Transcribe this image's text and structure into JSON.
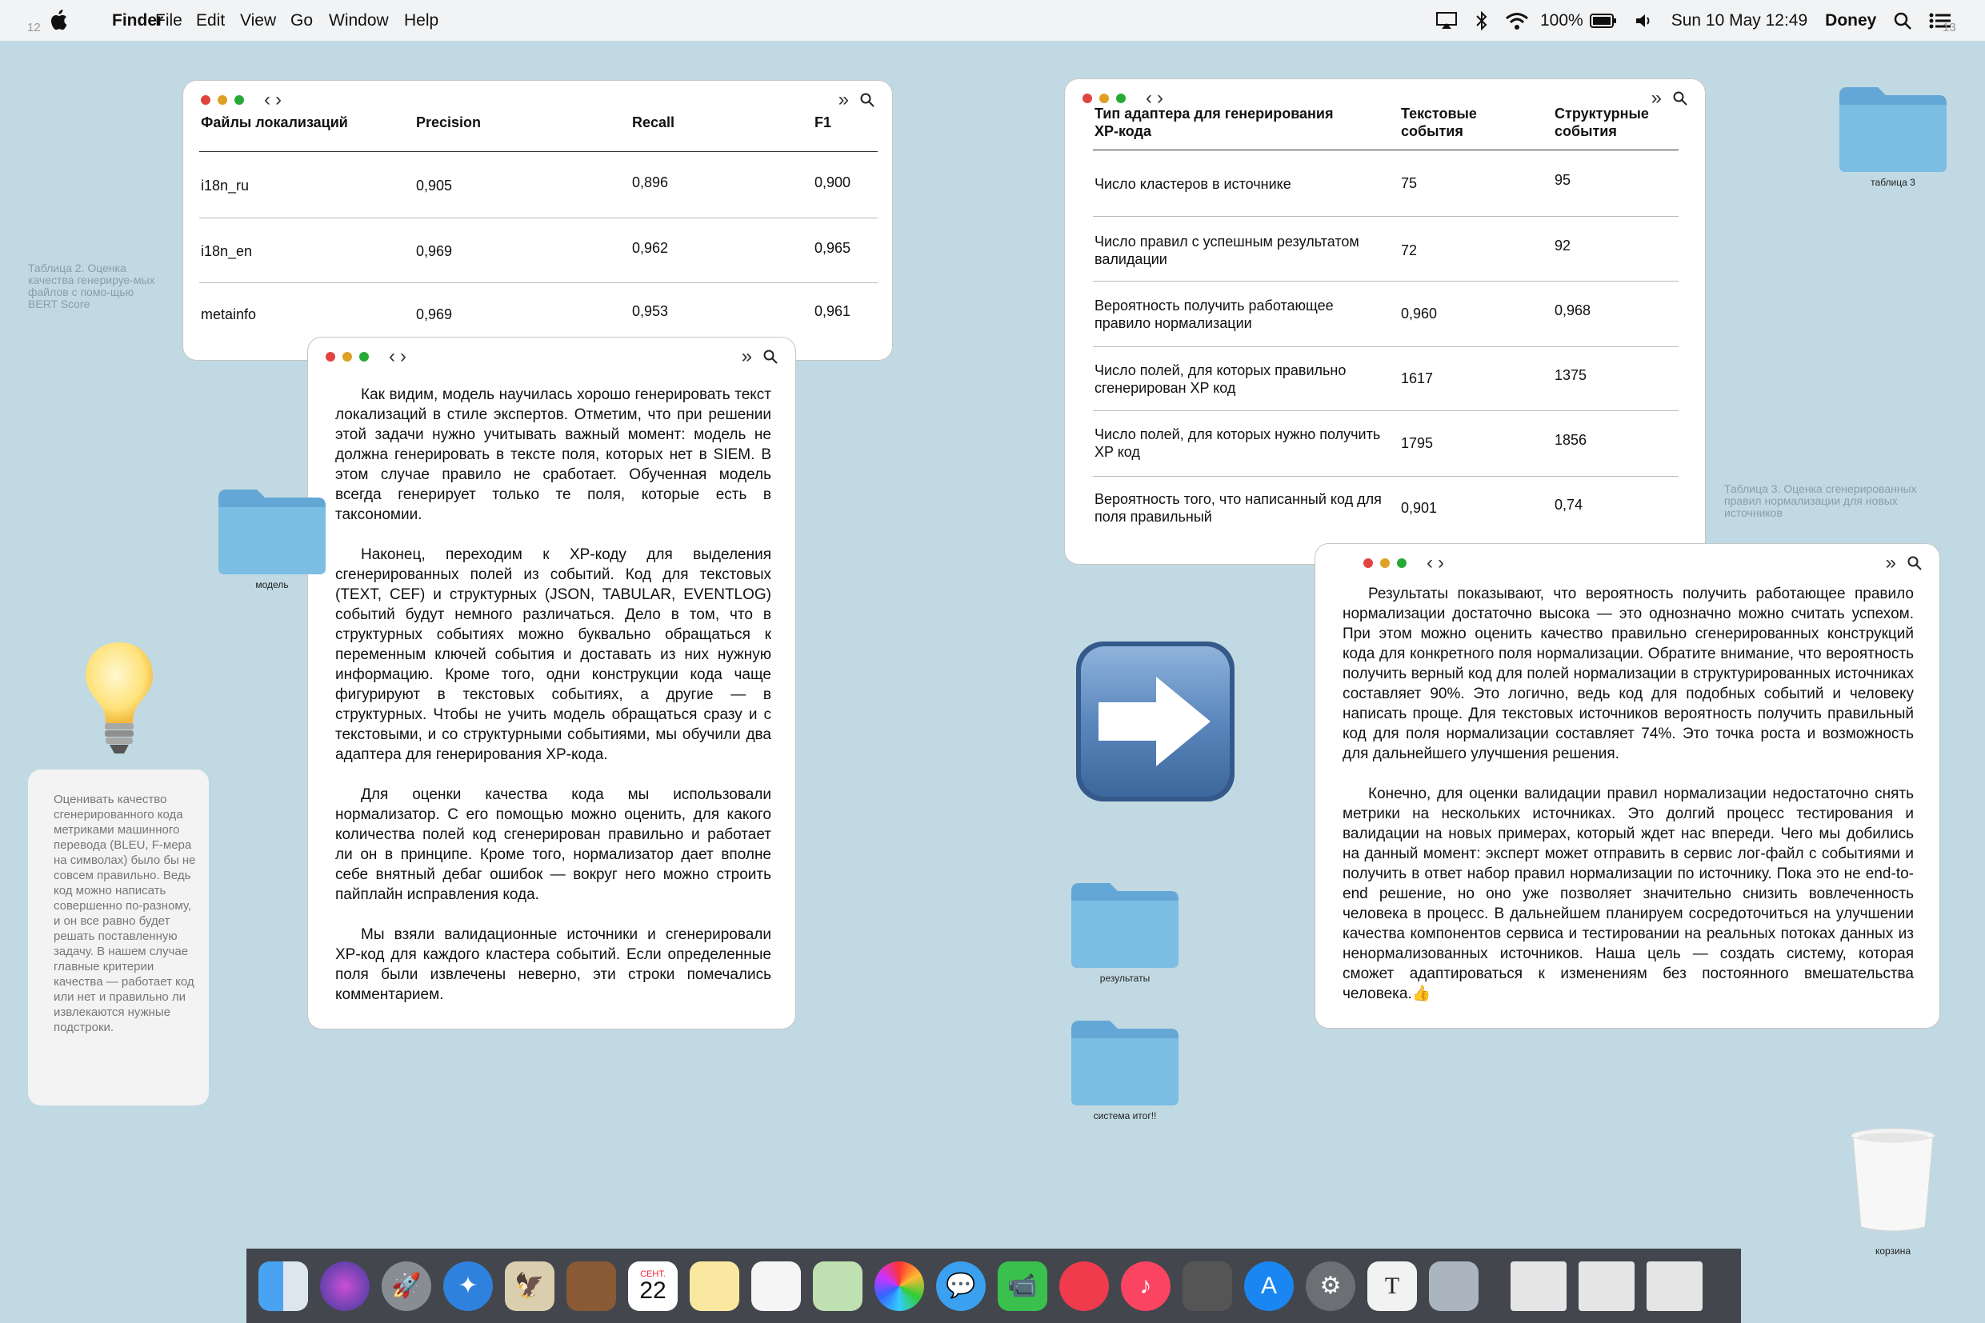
{
  "menubar": {
    "page_left": "12",
    "app_name": "Finder",
    "menus": [
      "File",
      "Edit",
      "View",
      "Go",
      "Window",
      "Help"
    ],
    "battery_percent": "100%",
    "datetime": "Sun 10 May  12:49",
    "user": "Doney",
    "page_right": "13"
  },
  "table2": {
    "headers": [
      "Файлы локализаций",
      "Precision",
      "Recall",
      "F1"
    ],
    "rows": [
      [
        "i18n_ru",
        "0,905",
        "0,896",
        "0,900"
      ],
      [
        "i18n_en",
        "0,969",
        "0,962",
        "0,965"
      ],
      [
        "metainfo",
        "0,969",
        "0,953",
        "0,961"
      ]
    ],
    "caption": "Таблица 2. Оценка качества генерируе-мых файлов с помо-щью BERT Score"
  },
  "text1": {
    "paragraphs": [
      "Как видим, модель научилась хорошо генерировать текст локализаций в стиле экспертов. Отметим, что при решении этой задачи нужно учитывать важный момент: модель не должна генерировать в тексте поля, которых нет в SIEM. В этом случае правило не сработает. Обученная модель всегда генерирует только те поля, которые есть в таксономии.",
      "Наконец, переходим к XP-коду для выделения сгенерированных полей из событий. Код для текстовых (TEXT, CEF) и структурных (JSON, TABULAR, EVENTLOG) событий будут немного различаться. Дело в том, что в структурных событиях можно буквально обращаться к переменным ключей события и доставать из них нужную информацию. Кроме того, одни конструкции кода чаще фигурируют в текстовых событиях, а другие — в структурных. Чтобы не учить модель обращаться сразу и с текстовыми, и со структурными событиями, мы обучили два адаптера для генерирования XP-кода.",
      "Для оценки качества кода мы использовали нормализатор. С его помощью можно оценить, для какого количества полей код сгенерирован правильно и работает ли он в принципе. Кроме того, нормализатор дает вполне себе внятный дебаг ошибок — вокруг него можно строить пайплайн исправления кода.",
      "Мы взяли валидационные источники и сгенерировали XP-код для каждого кластера событий. Если определенные поля были извлечены неверно, эти строки помечались комментарием."
    ]
  },
  "table3": {
    "headers": [
      "Тип адаптера для генерирования XP-кода",
      "Текстовые события",
      "Структурные события"
    ],
    "rows": [
      [
        "Число кластеров в источнике",
        "75",
        "95"
      ],
      [
        "Число правил с успешным результатом валидации",
        "72",
        "92"
      ],
      [
        "Вероятность получить работающее правило нормализации",
        "0,960",
        "0,968"
      ],
      [
        "Число полей, для которых правильно сгенерирован XP код",
        "1617",
        "1375"
      ],
      [
        "Число полей, для которых нужно получить XP код",
        "1795",
        "1856"
      ],
      [
        "Вероятность того, что написанный код для поля правильный",
        "0,901",
        "0,74"
      ]
    ],
    "caption": "Таблица 3. Оценка сгенерированных правил нормализации для новых источников"
  },
  "text2": {
    "paragraphs": [
      "Результаты показывают, что вероятность получить работающее правило нормализации достаточно высока — это однозначно можно считать успехом. При этом можно оценить качество правильно сгенерированных конструкций кода для конкретного поля нормализации. Обратите внимание, что вероятность получить верный код для полей нормализации в структурированных источниках составляет 90%. Это логично, ведь код для подобных событий и человеку написать проще. Для текстовых источников вероятность получить правильный код для поля нормализации составляет 74%. Это точка роста и возможность для дальнейшего улучшения решения.",
      "Конечно, для оценки валидации правил нормализации недостаточно снять метрики на нескольких источниках. Это долгий процесс тестирования и валидации на новых примерах, который ждет нас впереди. Чего мы добились на данный момент: эксперт может отправить в сервис лог-файл с событиями и получить в ответ набор правил нормализации по источнику. Пока это не end-to-end решение, но оно уже позволяет значительно снизить вовлеченность человека в процесс. В дальнейшем планируем сосредоточиться на улучшении качества компонентов сервиса и тестировании на реальных потоках данных из ненормализованных источников. Наша цель — создать систему, которая сможет адаптироваться к изменениям без постоянного вмешательства человека.👍"
    ]
  },
  "note": {
    "text": "Оценивать качество сгенерированного кода метриками машинного перевода (BLEU, F-мера на символах) было бы не совсем правильно. Ведь код можно написать совершенно по-разному, и он все равно будет решать поставленную задачу. В нашем случае главные критерии качества — работает код или нет и правильно ли извлекаются нужные подстроки."
  },
  "folders": {
    "model": "модель",
    "table3": "таблица 3",
    "results": "результаты",
    "system": "система итог!!",
    "trash": "корзина"
  },
  "dock": {
    "calendar_month": "СЕНТ.",
    "calendar_day": "22",
    "textedit_letter": "T"
  },
  "colors": {
    "desktop": "#c1d9e2",
    "folder": "#7cbde3",
    "dock": "#43464d"
  }
}
